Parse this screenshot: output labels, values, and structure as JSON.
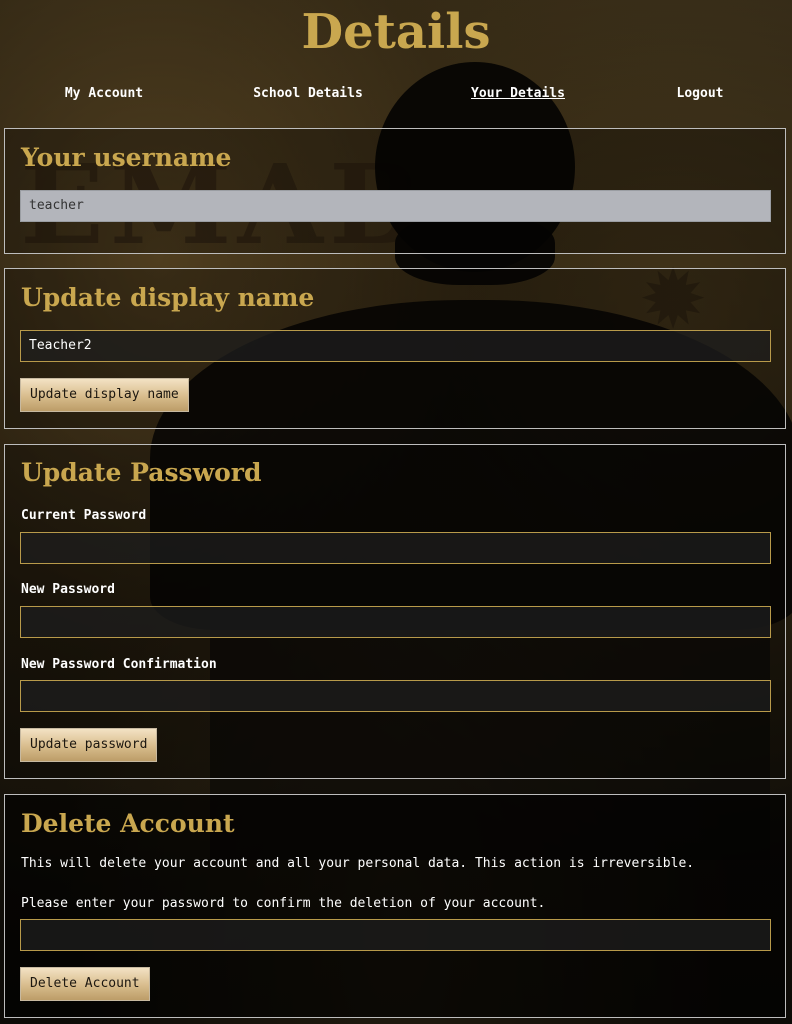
{
  "page": {
    "title": "Details"
  },
  "nav": {
    "items": [
      {
        "label": "My Account"
      },
      {
        "label": "School Details"
      },
      {
        "label": "Your Details"
      },
      {
        "label": "Logout"
      }
    ]
  },
  "username_section": {
    "heading": "Your username",
    "value": "teacher"
  },
  "display_name_section": {
    "heading": "Update display name",
    "value": "Teacher2",
    "button": "Update display name"
  },
  "password_section": {
    "heading": "Update Password",
    "current_label": "Current Password",
    "new_label": "New Password",
    "confirm_label": "New Password Confirmation",
    "button": "Update password"
  },
  "delete_section": {
    "heading": "Delete Account",
    "warning": "This will delete your account and all your personal data. This action is irreversible.",
    "instruction": "Please enter your password to confirm the deletion of your account.",
    "button": "Delete Account"
  },
  "theme": {
    "accent": "#c9a74f",
    "field_border": "#b89a4a",
    "panel_border": "#bdbdbd"
  }
}
